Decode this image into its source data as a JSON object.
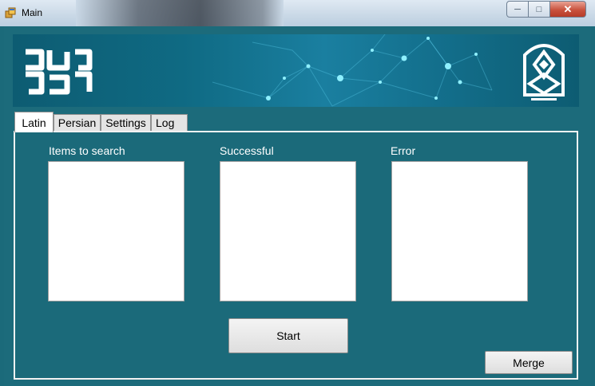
{
  "window": {
    "title": "Main"
  },
  "banner": {
    "logo_text": "جاج فراه"
  },
  "tabs": [
    {
      "label": "Latin",
      "active": true
    },
    {
      "label": "Persian",
      "active": false
    },
    {
      "label": "Settings",
      "active": false
    },
    {
      "label": "Log",
      "active": false
    }
  ],
  "lists": {
    "items_label": "Items to search",
    "successful_label": "Successful",
    "error_label": "Error"
  },
  "buttons": {
    "start": "Start",
    "merge": "Merge"
  },
  "icons": {
    "minimize": "minimize-icon",
    "maximize": "maximize-icon",
    "close": "close-icon"
  }
}
